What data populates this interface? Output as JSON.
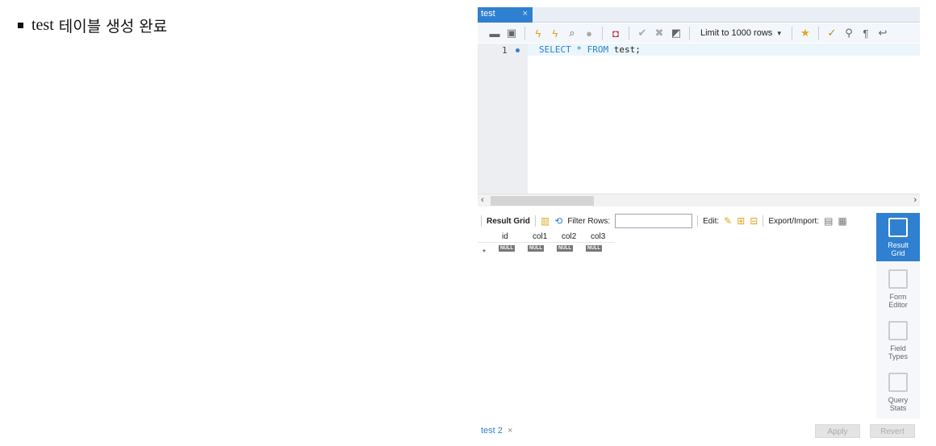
{
  "caption": {
    "bullet_text": "test",
    "korean_text": "테이블 생성 완료"
  },
  "editor_tab": {
    "label": "test",
    "close": "×"
  },
  "toolbar": {
    "icons": [
      "open-folder-icon",
      "save-icon",
      "execute-icon",
      "execute-current-icon",
      "explain-icon",
      "stop-icon",
      "toggle-error-icon",
      "commit-icon",
      "rollback-icon",
      "autocommit-icon",
      "beautify-icon",
      "find-icon",
      "invisible-chars-icon",
      "wrap-icon"
    ],
    "limit_label": "Limit to 1000 rows",
    "limit_arrow": "▾"
  },
  "editor": {
    "line_number": "1",
    "code_keyword": "SELECT * FROM ",
    "code_ident": "test;"
  },
  "scroll": {
    "left": "‹",
    "right": "›"
  },
  "results": {
    "result_grid_label": "Result Grid",
    "filter_label": "Filter Rows:",
    "filter_value": "",
    "edit_label": "Edit:",
    "export_label": "Export/Import:",
    "columns": [
      "id",
      "col1",
      "col2",
      "col3"
    ],
    "null_text": "NULL",
    "row_marker": "*"
  },
  "side_panel": {
    "items": [
      {
        "label1": "Result",
        "label2": "Grid"
      },
      {
        "label1": "Form",
        "label2": "Editor"
      },
      {
        "label1": "Field",
        "label2": "Types"
      },
      {
        "label1": "Query",
        "label2": "Stats"
      }
    ]
  },
  "bottom": {
    "tab_label": "test 2",
    "tab_close": "×",
    "apply": "Apply",
    "revert": "Revert"
  },
  "colors": {
    "accent": "#2f80d0",
    "tab_bg": "#2f80d0"
  }
}
